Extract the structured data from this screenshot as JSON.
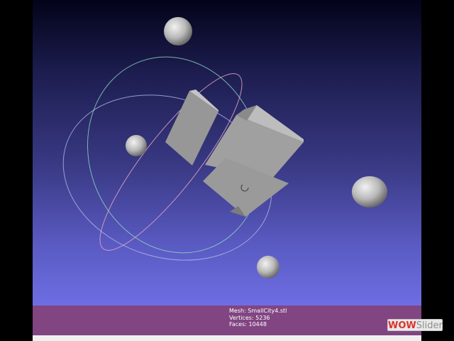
{
  "mesh_info": {
    "mesh_line": "Mesh: SmallCity4.stl",
    "vertices_line": "Vertices: 5236",
    "faces_line": "Faces: 10448"
  },
  "watermark": {
    "part_a": "WOW",
    "part_b": "Slider"
  },
  "colors": {
    "info_bar": "#814582",
    "background_top": "#03031a",
    "background_bottom": "#6e6ee4",
    "mesh": "#9c9c9c"
  }
}
